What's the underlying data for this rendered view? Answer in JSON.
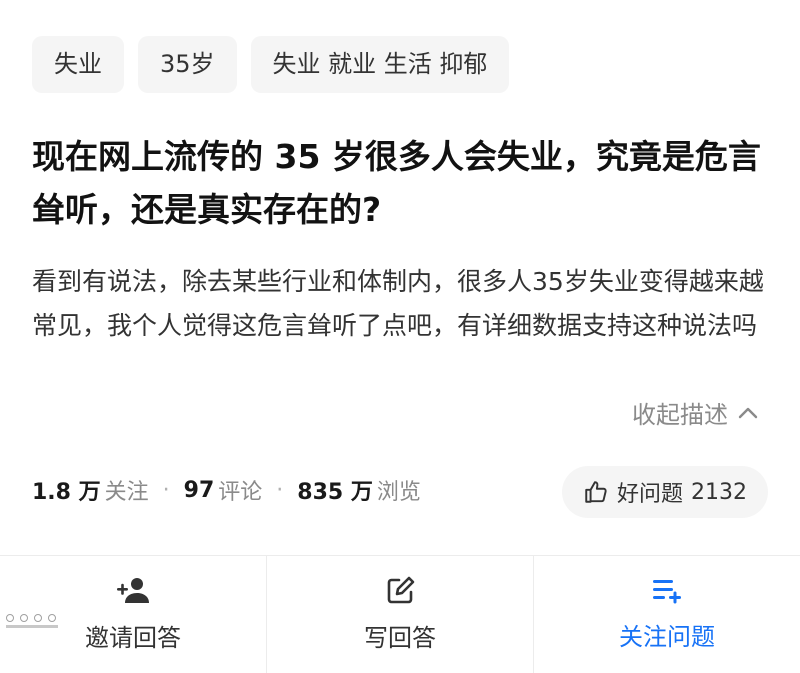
{
  "tags": [
    "失业",
    "35岁",
    "失业 就业 生活 抑郁"
  ],
  "question": {
    "title": "现在网上流传的 35 岁很多人会失业，究竟是危言耸听，还是真实存在的?",
    "description": "看到有说法，除去某些行业和体制内，很多人35岁失业变得越来越常见，我个人觉得这危言耸听了点吧，有详细数据支持这种说法吗",
    "collapse_label": "收起描述"
  },
  "stats": {
    "followers_count": "1.8 万",
    "followers_label": "关注",
    "comments_count": "97",
    "comments_label": "评论",
    "views_count": "835 万",
    "views_label": "浏览",
    "separator": "·"
  },
  "good_question": {
    "label": "好问题",
    "count": "2132",
    "icon": "thumbs-up-icon"
  },
  "actions": [
    {
      "label": "邀请回答",
      "icon": "add-user-icon"
    },
    {
      "label": "写回答",
      "icon": "edit-icon"
    },
    {
      "label": "关注问题",
      "icon": "add-list-icon"
    }
  ],
  "colors": {
    "accent": "#1772f6",
    "tag_bg": "#f5f5f5",
    "muted_text": "#8a8a8a"
  }
}
